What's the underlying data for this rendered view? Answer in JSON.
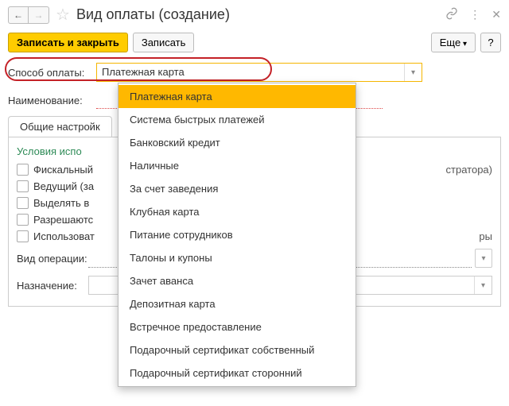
{
  "title": "Вид оплаты (создание)",
  "toolbar": {
    "save_close": "Записать и закрыть",
    "save": "Записать",
    "more": "Еще",
    "help": "?"
  },
  "fields": {
    "payment_method_label": "Способ оплаты:",
    "payment_method_value": "Платежная карта",
    "name_label": "Наименование:"
  },
  "tab_general": "Общие настройк",
  "section_conditions": "Условия испо",
  "checks": {
    "fiscal": "Фискальный",
    "leading": "Ведущий (за",
    "highlight": "Выделять в",
    "allow": "Разрешаютс",
    "use": "Использоват"
  },
  "trailing": {
    "admin": "стратора)",
    "ry": "ры"
  },
  "op_label": "Вид операции:",
  "dest_label": "Назначение:",
  "dropdown": {
    "items": [
      "Платежная карта",
      "Система быстрых платежей",
      "Банковский кредит",
      "Наличные",
      "За счет заведения",
      "Клубная карта",
      "Питание сотрудников",
      "Талоны и купоны",
      "Зачет аванса",
      "Депозитная карта",
      "Встречное предоставление",
      "Подарочный сертификат собственный",
      "Подарочный сертификат сторонний"
    ],
    "selected_index": 0
  }
}
